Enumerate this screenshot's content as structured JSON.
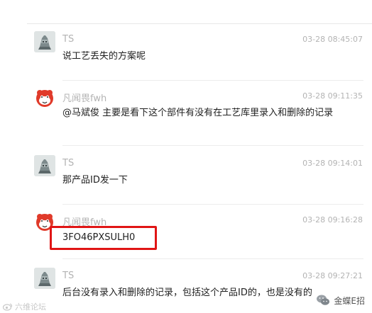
{
  "messages": [
    {
      "sender": "TS",
      "time": "03-28 08:45:07",
      "text": "说工艺丢失的方案呢",
      "avatar": "ts-avatar"
    },
    {
      "sender": "凡闻畏fwh",
      "time": "03-28 09:11:35",
      "text": "@马斌俊 主要是看下这个部件有没有在工艺库里录入和删除的记录",
      "avatar": "red-mascot-avatar"
    },
    {
      "sender": "TS",
      "time": "03-28 09:14:01",
      "text": "那产品ID发一下",
      "avatar": "ts-avatar"
    },
    {
      "sender": "凡闻畏fwh",
      "time": "03-28 09:16:28",
      "text": "3FO46PXSULH0",
      "avatar": "red-mascot-avatar",
      "highlighted": true
    },
    {
      "sender": "TS",
      "time": "03-28 09:27:21",
      "text": "后台没有录入和删除的记录，包括这个产品ID的，也是没有的",
      "avatar": "ts-avatar"
    }
  ],
  "highlight_color": "#e01515",
  "watermarks": {
    "left": "六维论坛",
    "right": "金蝶E招"
  }
}
